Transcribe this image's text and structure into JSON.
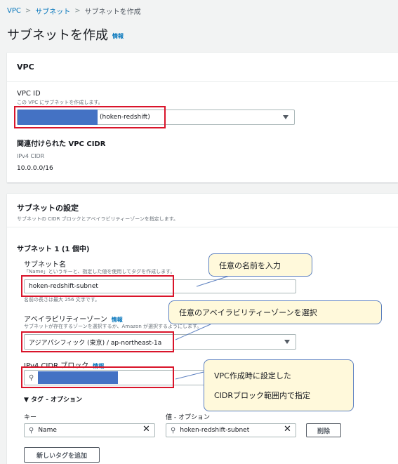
{
  "breadcrumb": {
    "vpc": "VPC",
    "subnets": "サブネット",
    "current": "サブネットを作成"
  },
  "page": {
    "title": "サブネットを作成",
    "info": "情報"
  },
  "vpc_panel": {
    "header": "VPC",
    "vpc_id_label": "VPC ID",
    "vpc_id_desc": "この VPC にサブネットを作成します。",
    "vpc_id_value": "(hoken-redshift)",
    "cidr_heading": "関連付けられた VPC CIDR",
    "ipv4_label": "IPv4 CIDR",
    "ipv4_value": "10.0.0.0/16"
  },
  "subnet_panel": {
    "header": "サブネットの設定",
    "desc": "サブネットの CIDR ブロックとアベイラビリティーゾーンを指定します。",
    "subnet_title": "サブネット 1 (1 個中)",
    "name_label": "サブネット名",
    "name_desc": "「Name」というキーと、指定した値を使用してタグを作成します。",
    "name_value": "hoken-redshift-subnet",
    "name_hint": "名前の長さは最大 256 文字です。",
    "az_label": "アベイラビリティーゾーン",
    "az_info": "情報",
    "az_desc": "サブネットが存在するゾーンを選択するか、Amazon が選択するようにします。",
    "az_value": "アジアパシフィック (東京) / ap-northeast-1a",
    "cidr_label": "IPv4 CIDR ブロック",
    "cidr_info": "情報",
    "tags_toggle": "▼ タグ - オプション",
    "key_label": "キー",
    "value_label": "値 - オプション",
    "tag_key": "Name",
    "tag_value": "hoken-redshift-subnet",
    "remove_button": "削除",
    "add_tag_button": "新しいタグを追加"
  },
  "callouts": {
    "name": "任意の名前を入力",
    "az": "任意のアベイラビリティーゾーンを選択",
    "cidr_line1": "VPC作成時に設定した",
    "cidr_line2": "CIDRブロック範囲内で指定"
  },
  "colors": {
    "accent": "#0073bb",
    "highlight_box": "#d9142a",
    "callout_bg": "#fff9db",
    "mask": "#4472c4"
  }
}
